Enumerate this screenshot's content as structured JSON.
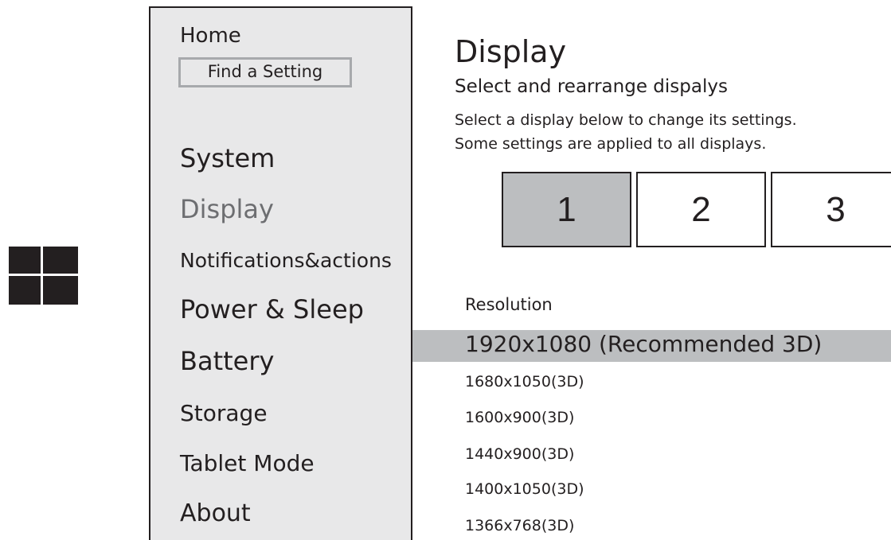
{
  "icons": {
    "start": "windows-logo-icon"
  },
  "colors": {
    "sidebar_bg": "#e8e8e9",
    "selected_bg": "#bcbec0",
    "active_text": "#6d6e71",
    "text": "#231f20"
  },
  "sidebar": {
    "home_label": "Home",
    "search_label": "Find a Setting",
    "items": [
      {
        "label": "System",
        "active": false
      },
      {
        "label": "Display",
        "active": true
      },
      {
        "label": "Notifications&actions",
        "active": false
      },
      {
        "label": "Power & Sleep",
        "active": false
      },
      {
        "label": "Battery",
        "active": false
      },
      {
        "label": "Storage",
        "active": false
      },
      {
        "label": "Tablet Mode",
        "active": false
      },
      {
        "label": "About",
        "active": false
      }
    ]
  },
  "main": {
    "title": "Display",
    "subtitle": "Select and rearrange dispalys",
    "description": [
      "Select a display below to change its settings.",
      "Some settings are applied to all displays."
    ],
    "displays": [
      {
        "label": "1",
        "selected": true
      },
      {
        "label": "2",
        "selected": false
      },
      {
        "label": "3",
        "selected": false
      }
    ],
    "resolution": {
      "label": "Resolution",
      "selected": "1920x1080 (Recommended 3D)",
      "options": [
        "1680x1050(3D)",
        "1600x900(3D)",
        "1440x900(3D)",
        "1400x1050(3D)",
        "1366x768(3D)"
      ]
    }
  }
}
